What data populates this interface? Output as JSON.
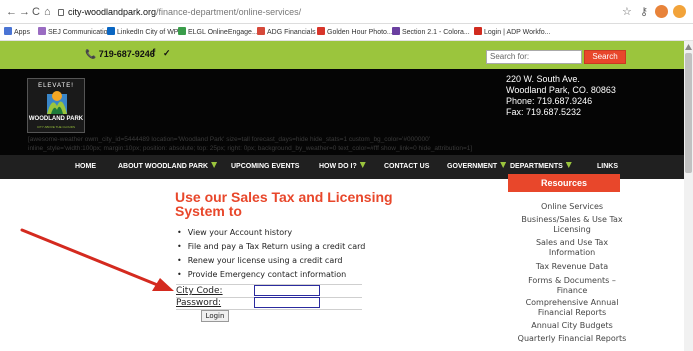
{
  "browser": {
    "back_icon": "←",
    "forward_icon": "→",
    "reload_icon": "C",
    "home_icon": "⌂",
    "url_host": "city-woodlandpark.org",
    "url_path": "/finance-department/online-services/",
    "star_icon": "☆",
    "key_icon": "⚷",
    "bookmarks": [
      {
        "label": "Apps",
        "color": "#4a74d4"
      },
      {
        "label": "SEJ Communicatio...",
        "color": "#9a6cc2"
      },
      {
        "label": "LinkedIn City of WP",
        "color": "#0a66c2"
      },
      {
        "label": "ELGL OnlineEngage...",
        "color": "#3a9d4a"
      },
      {
        "label": "ADG Financials",
        "color": "#d6493a"
      },
      {
        "label": "Golden Hour Photo...",
        "color": "#d8352a"
      },
      {
        "label": "Section 2.1 - Colora...",
        "color": "#6a3fa0"
      },
      {
        "label": "Login | ADP Workfo...",
        "color": "#d12b1f"
      }
    ]
  },
  "topbar": {
    "phone": "719-687-9246",
    "facebook_icon": "f",
    "twitter_icon": "🐦",
    "search_placeholder": "Search for:",
    "search_button": "Search"
  },
  "header": {
    "logo_top": "ELEVATE!",
    "logo_name": "WOODLAND PARK",
    "logo_tagline": "CITY ABOVE THE CLOUDS",
    "address": [
      "220 W. South Ave.",
      "Woodland Park, CO. 80863",
      "Phone: 719.687.9246",
      "Fax: 719.687.5232"
    ],
    "widget_code": [
      "[awesome-weather owm_city_id=5444489 location='Woodland Park' size=tall forecast_days=hide hide_stats=1 custom_bg_color='#000000'",
      "inline_style='width:100px; margin:10px; position: absolute; top: 25px; right: 0px; background_by_weather=0 text_color=#fff show_link=0 hide_attribution=1]"
    ]
  },
  "nav": [
    {
      "label": "HOME",
      "dropdown": false
    },
    {
      "label": "ABOUT WOODLAND PARK",
      "dropdown": true
    },
    {
      "label": "UPCOMING EVENTS",
      "dropdown": false
    },
    {
      "label": "HOW DO I?",
      "dropdown": true
    },
    {
      "label": "CONTACT US",
      "dropdown": false
    },
    {
      "label": "GOVERNMENT",
      "dropdown": true
    },
    {
      "label": "DEPARTMENTS",
      "dropdown": true
    },
    {
      "label": "LINKS",
      "dropdown": false
    }
  ],
  "main": {
    "title": "Use our Sales Tax and Licensing System to",
    "bullets": [
      "View your Account history",
      "File and pay a Tax Return using a credit card",
      "Renew your license using a credit card",
      "Provide Emergency contact information"
    ],
    "city_code_label": "City Code:",
    "password_label": "Password:",
    "login_button": "Login"
  },
  "sidebar": {
    "heading": "Resources",
    "items": [
      "Online Services",
      "Business/Sales & Use Tax Licensing",
      "Sales and Use Tax Information",
      "Tax Revenue Data",
      "Forms & Documents – Finance",
      "Comprehensive Annual Financial Reports",
      "Annual City Budgets",
      "Quarterly Financial Reports"
    ]
  },
  "colors": {
    "accent_green": "#9bc53d",
    "accent_orange": "#e8472b",
    "arrow_red": "#d42a1f"
  }
}
